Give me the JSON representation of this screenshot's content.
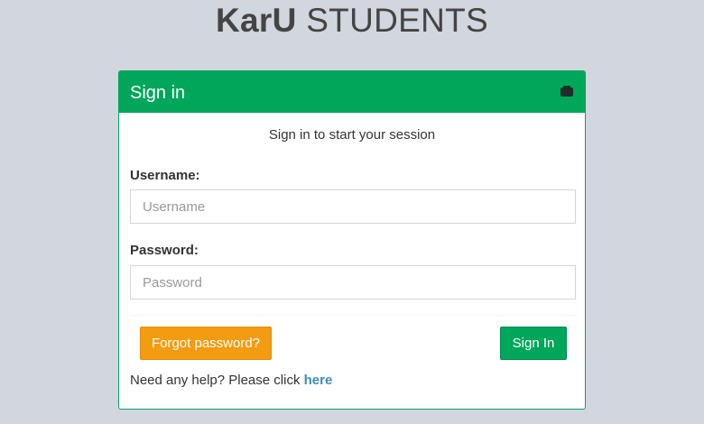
{
  "logo": {
    "brand": "KarU",
    "suffix": "STUDENTS"
  },
  "login_box": {
    "title": "Sign in",
    "tool_icon": "collapse-icon",
    "message": "Sign in to start your session",
    "username": {
      "label": "Username:",
      "placeholder": "Username",
      "value": ""
    },
    "password": {
      "label": "Password:",
      "placeholder": "Password",
      "value": ""
    },
    "forgot_button": "Forgot password?",
    "signin_button": "Sign In",
    "help_text": "Need any help? Please click ",
    "help_link": "here"
  },
  "colors": {
    "background": "#d2d6de",
    "header": "#00a65a",
    "forgot_button": "#f39c12",
    "signin_button": "#00a65a",
    "link": "#3c8dbc"
  }
}
